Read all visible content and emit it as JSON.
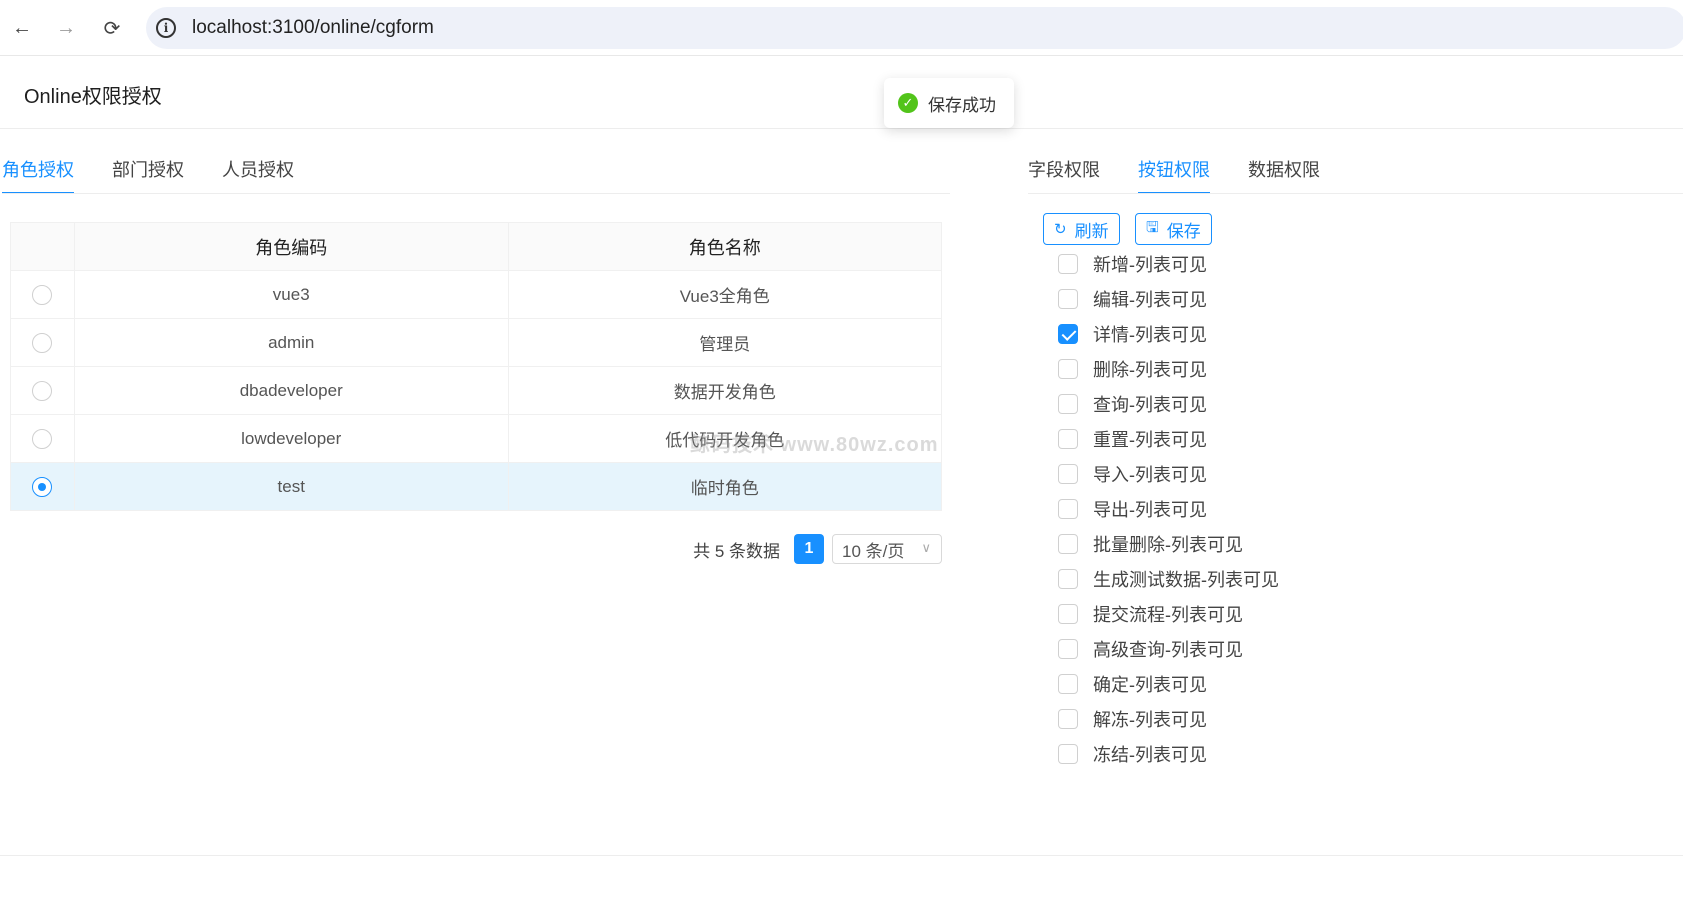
{
  "browser": {
    "url": "localhost:3100/online/cgform",
    "back_icon": "←",
    "forward_icon": "→",
    "reload_icon": "⟳",
    "info_icon": "i"
  },
  "modal": {
    "title": "Online权限授权"
  },
  "toast": {
    "message": "保存成功",
    "icon": "✓"
  },
  "left_tabs": [
    {
      "label": "角色授权",
      "active": true
    },
    {
      "label": "部门授权",
      "active": false
    },
    {
      "label": "人员授权",
      "active": false
    }
  ],
  "table": {
    "columns": [
      "角色编码",
      "角色名称"
    ],
    "rows": [
      {
        "code": "vue3",
        "name": "Vue3全角色",
        "selected": false
      },
      {
        "code": "admin",
        "name": "管理员",
        "selected": false
      },
      {
        "code": "dbadeveloper",
        "name": "数据开发角色",
        "selected": false
      },
      {
        "code": "lowdeveloper",
        "name": "低代码开发角色",
        "selected": false
      },
      {
        "code": "test",
        "name": "临时角色",
        "selected": true
      }
    ]
  },
  "pagination": {
    "total_text": "共 5 条数据",
    "current_page": "1",
    "page_size": "10 条/页",
    "chevron": "∨"
  },
  "watermark": "鲸码技术 www.80wz.com",
  "right_tabs": [
    {
      "label": "字段权限",
      "active": false
    },
    {
      "label": "按钮权限",
      "active": true
    },
    {
      "label": "数据权限",
      "active": false
    }
  ],
  "actions": {
    "refresh_label": "刷新",
    "refresh_icon": "↻",
    "save_label": "保存",
    "save_icon": "🖫"
  },
  "permissions": [
    {
      "label": "新增-列表可见",
      "checked": false
    },
    {
      "label": "编辑-列表可见",
      "checked": false
    },
    {
      "label": "详情-列表可见",
      "checked": true
    },
    {
      "label": "删除-列表可见",
      "checked": false
    },
    {
      "label": "查询-列表可见",
      "checked": false
    },
    {
      "label": "重置-列表可见",
      "checked": false
    },
    {
      "label": "导入-列表可见",
      "checked": false
    },
    {
      "label": "导出-列表可见",
      "checked": false
    },
    {
      "label": "批量删除-列表可见",
      "checked": false
    },
    {
      "label": "生成测试数据-列表可见",
      "checked": false
    },
    {
      "label": "提交流程-列表可见",
      "checked": false
    },
    {
      "label": "高级查询-列表可见",
      "checked": false
    },
    {
      "label": "确定-列表可见",
      "checked": false
    },
    {
      "label": "解冻-列表可见",
      "checked": false
    },
    {
      "label": "冻结-列表可见",
      "checked": false
    }
  ],
  "colors": {
    "primary": "#1890ff",
    "success": "#52c41a",
    "selected_row": "#e6f4fc"
  }
}
